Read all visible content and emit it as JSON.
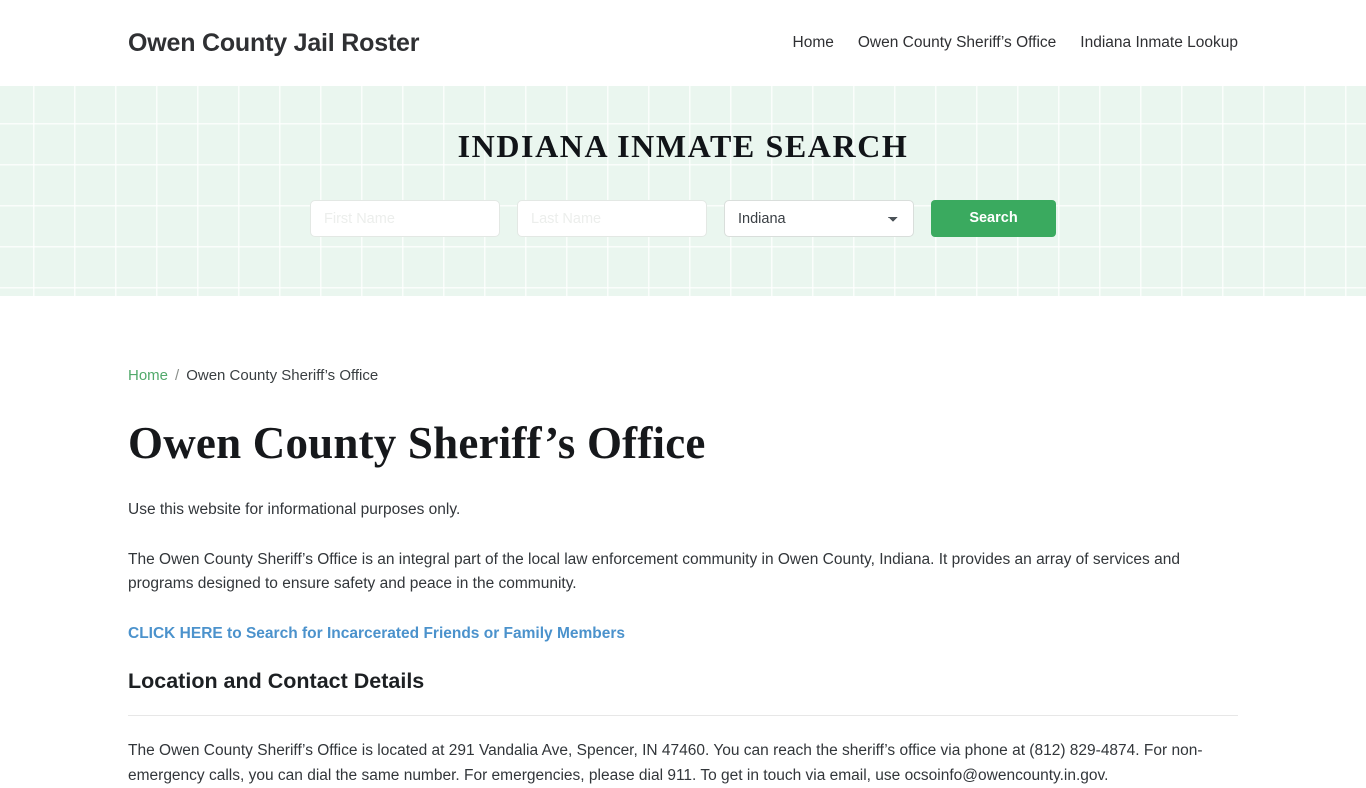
{
  "header": {
    "brand": "Owen County Jail Roster",
    "nav": [
      {
        "label": "Home"
      },
      {
        "label": "Owen County Sheriff’s Office"
      },
      {
        "label": "Indiana Inmate Lookup"
      }
    ]
  },
  "hero": {
    "title": "INDIANA INMATE SEARCH",
    "background_color": "#eaf6ef",
    "form": {
      "first_name_placeholder": "First Name",
      "first_name_value": "",
      "last_name_placeholder": "Last Name",
      "last_name_value": "",
      "state_selected": "Indiana",
      "state_options": [
        "Indiana"
      ],
      "submit_label": "Search",
      "submit_color": "#3aaa5f",
      "dropdown_icon": "chevron-down-icon"
    }
  },
  "breadcrumb": {
    "home_label": "Home",
    "separator": "/",
    "current_label": "Owen County Sheriff’s Office",
    "link_color": "#51a96b"
  },
  "main": {
    "page_title": "Owen County Sheriff’s Office",
    "intro_note": "Use this website for informational purposes only.",
    "description": "The Owen County Sheriff’s Office is an integral part of the local law enforcement community in Owen County, Indiana. It provides an array of services and programs designed to ensure safety and peace in the community.",
    "cta_label": "CLICK HERE to Search for Incarcerated Friends or Family Members",
    "cta_color": "#4b92cc",
    "section_heading": "Location and Contact Details",
    "contact_paragraph": "The Owen County Sheriff’s Office is located at 291 Vandalia Ave, Spencer, IN 47460. You can reach the sheriff’s office via phone at (812) 829-4874. For non-emergency calls, you can dial the same number. For emergencies, please dial 911. To get in touch via email, use ocsoinfo@owencounty.in.gov."
  }
}
